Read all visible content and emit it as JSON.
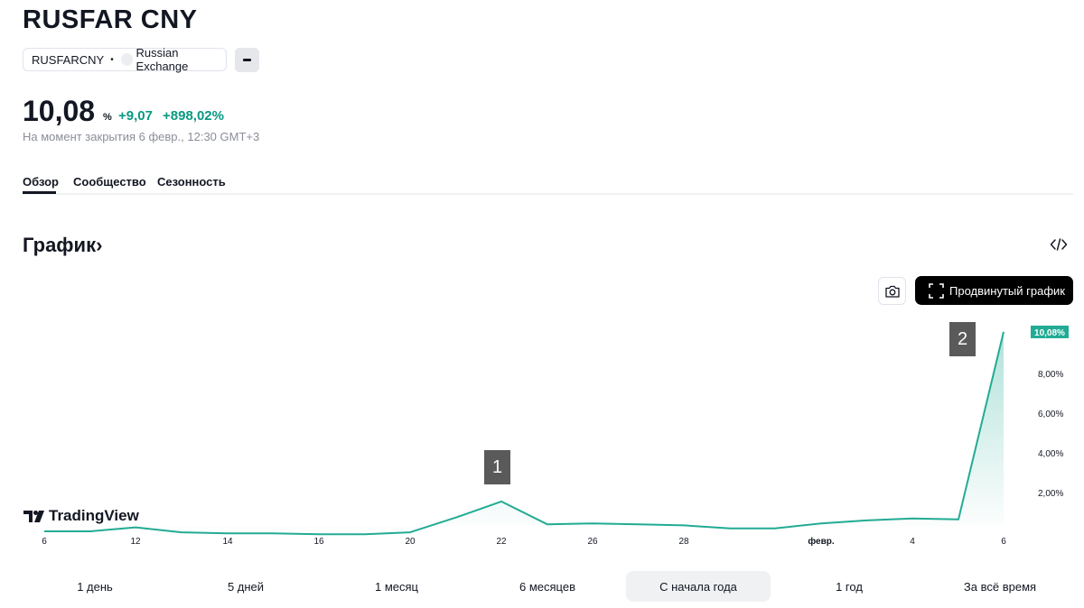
{
  "header": {
    "title": "RUSFAR CNY",
    "symbol": "RUSFARCNY",
    "separator": "•",
    "exchange": "Russian Exchange"
  },
  "quote": {
    "price": "10,08",
    "unit": "%",
    "change": "+9,07",
    "change_percent": "+898,02%",
    "status": "На момент закрытия 6 февр., 12:30 GMT+3",
    "positive_color": "#089981"
  },
  "tabs": [
    "Обзор",
    "Сообщество",
    "Сезонность"
  ],
  "section": {
    "title": "График›"
  },
  "toolbar": {
    "camera_icon": "camera-icon",
    "advanced_chart_label": "Продвинутый график"
  },
  "chart_data": {
    "type": "area",
    "x_tick_labels": [
      "6",
      "12",
      "14",
      "16",
      "20",
      "22",
      "26",
      "28",
      "февр.",
      "4",
      "6"
    ],
    "x": [
      "янв 6",
      "янв 9",
      "янв 12",
      "янв 13",
      "янв 14",
      "янв 15",
      "янв 16",
      "янв 19",
      "янв 20",
      "янв 21",
      "янв 22",
      "янв 23",
      "янв 26",
      "янв 27",
      "янв 28",
      "янв 29",
      "янв 30",
      "февр 2",
      "февр 3",
      "февр 4",
      "февр 5",
      "февр 6"
    ],
    "series": [
      {
        "values": [
          0.05,
          0.05,
          0.25,
          0.0,
          -0.05,
          -0.05,
          -0.1,
          -0.1,
          0.0,
          0.75,
          1.55,
          0.4,
          0.45,
          0.4,
          0.35,
          0.2,
          0.2,
          0.45,
          0.6,
          0.7,
          0.65,
          10.08
        ],
        "color": "#22ab94"
      }
    ],
    "y_tick_labels": [
      "2,00%",
      "4,00%",
      "6,00%",
      "8,00%"
    ],
    "y_ticks": [
      2,
      4,
      6,
      8
    ],
    "ylim": [
      -0.45,
      10.35
    ],
    "last_value_label": "10,08%",
    "markers": [
      "1",
      "2"
    ],
    "grid": false
  },
  "watermark": "TradingView",
  "ranges": [
    "1 день",
    "5 дней",
    "1 месяц",
    "6 месяцев",
    "С начала года",
    "1 год",
    "За всё время"
  ],
  "active_range": "С начала года"
}
